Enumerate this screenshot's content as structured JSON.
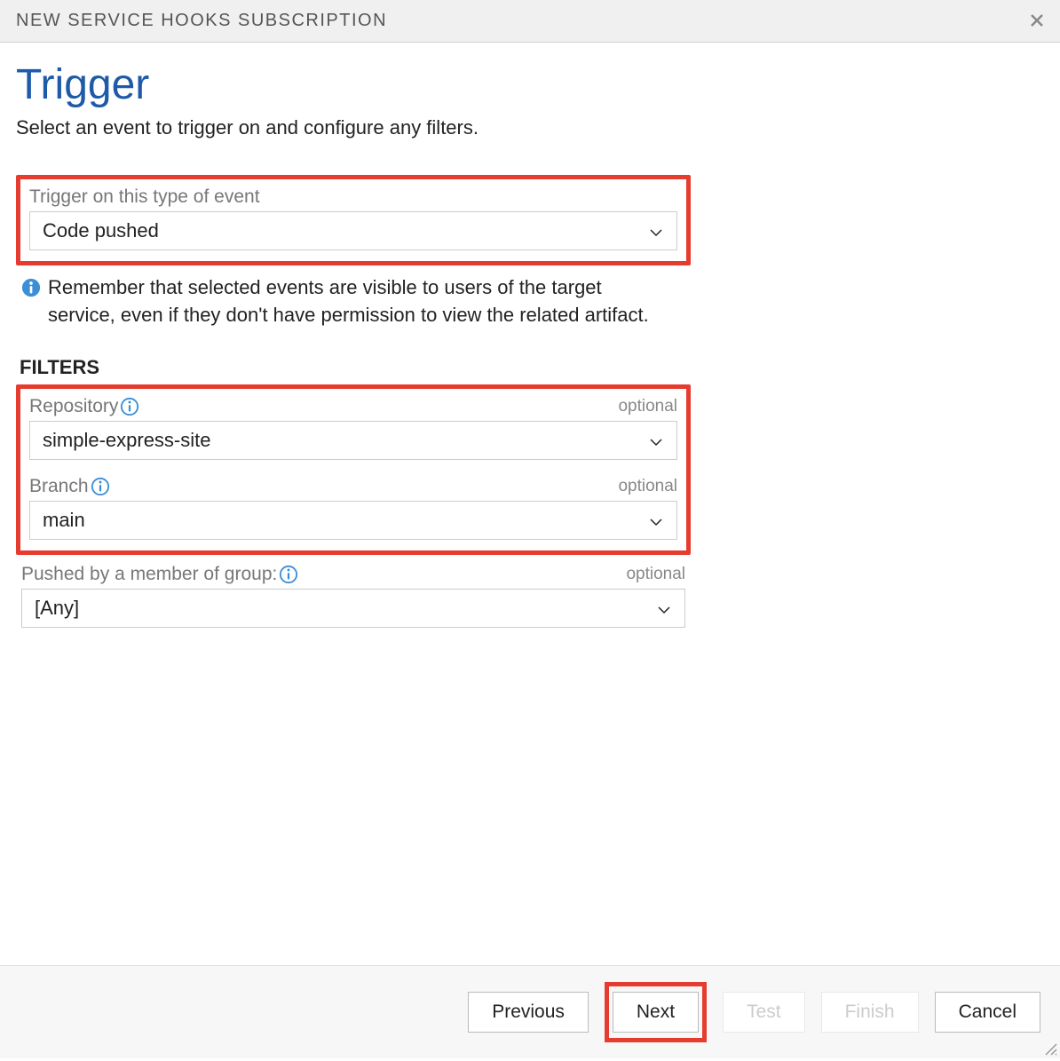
{
  "dialog": {
    "title": "NEW SERVICE HOOKS SUBSCRIPTION"
  },
  "page": {
    "heading": "Trigger",
    "subtitle": "Select an event to trigger on and configure any filters."
  },
  "trigger": {
    "label": "Trigger on this type of event",
    "value": "Code pushed"
  },
  "info": {
    "text": "Remember that selected events are visible to users of the target service, even if they don't have permission to view the related artifact."
  },
  "filters": {
    "header": "FILTERS",
    "repository": {
      "label": "Repository",
      "optional": "optional",
      "value": "simple-express-site"
    },
    "branch": {
      "label": "Branch",
      "optional": "optional",
      "value": "main"
    },
    "pushed_by": {
      "label": "Pushed by a member of group:",
      "optional": "optional",
      "value": "[Any]"
    }
  },
  "footer": {
    "previous": "Previous",
    "next": "Next",
    "test": "Test",
    "finish": "Finish",
    "cancel": "Cancel"
  }
}
